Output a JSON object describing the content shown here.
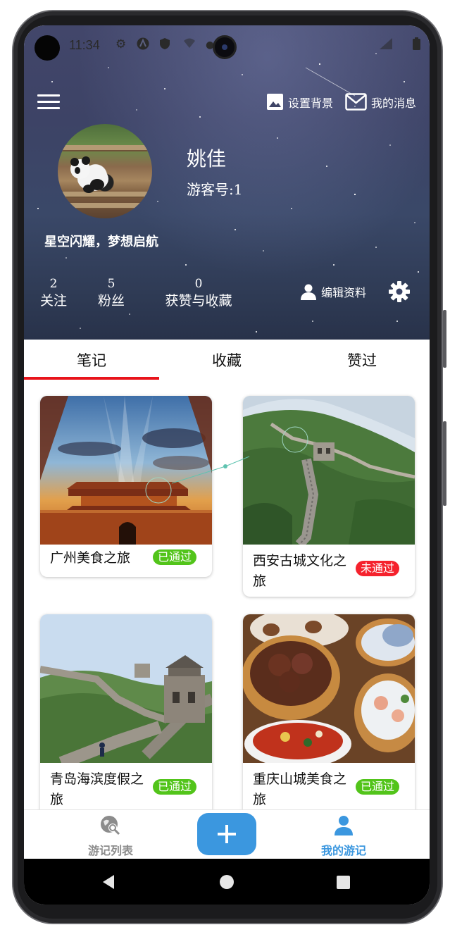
{
  "status_bar": {
    "time": "11:34",
    "icons": [
      "gear-icon",
      "a-icon",
      "shield-icon",
      "wifi-icon",
      "dot-icon",
      "signal-icon",
      "battery-icon"
    ]
  },
  "header": {
    "set_background_label": "设置背景",
    "messages_label": "我的消息",
    "user_name": "姚佳",
    "user_id": "游客号:1",
    "motto": "星空闪耀，梦想启航",
    "stats": [
      {
        "value": "2",
        "label": "关注"
      },
      {
        "value": "5",
        "label": "粉丝"
      },
      {
        "value": "0",
        "label": "获赞与收藏"
      }
    ],
    "edit_profile_label": "编辑资料"
  },
  "tabs": [
    {
      "label": "笔记",
      "active": true
    },
    {
      "label": "收藏",
      "active": false
    },
    {
      "label": "赞过",
      "active": false
    }
  ],
  "cards": [
    {
      "title": "广州美食之旅",
      "status": "已通过",
      "status_color": "#52c41a"
    },
    {
      "title": "西安古城文化之旅",
      "status": "未通过",
      "status_color": "#f5222d"
    },
    {
      "title": "青岛海滨度假之旅",
      "status": "已通过",
      "status_color": "#52c41a"
    },
    {
      "title": "重庆山城美食之旅",
      "status": "已通过",
      "status_color": "#52c41a"
    }
  ],
  "bottom_nav": {
    "items": [
      {
        "label": "游记列表",
        "icon": "search-globe-icon",
        "active": false
      },
      {
        "label": "我的游记",
        "icon": "person-icon",
        "active": true
      }
    ],
    "add_icon": "plus-icon",
    "active_color": "#3b97df",
    "inactive_color": "#8c8c8c"
  },
  "colors": {
    "tab_indicator": "#e8141b",
    "fab": "#3b97df"
  }
}
